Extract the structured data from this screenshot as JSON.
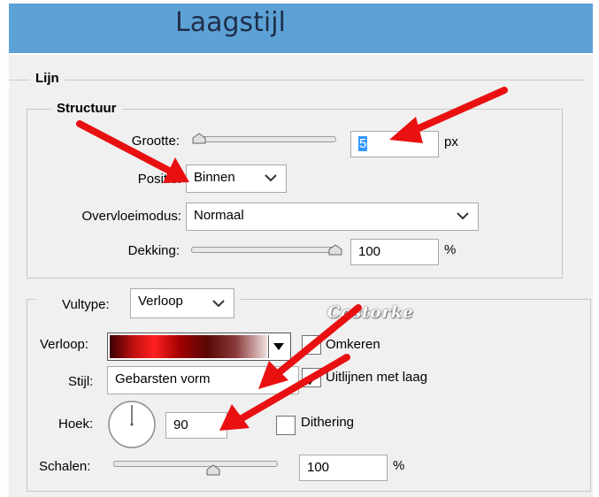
{
  "window": {
    "title": "Laagstijl"
  },
  "section": {
    "title": "Lijn"
  },
  "structure": {
    "title": "Structuur",
    "size_label": "Grootte:",
    "size_value": "5",
    "size_unit": "px",
    "size_slider_fraction": 0.05,
    "position_label": "Positie:",
    "position_value": "Binnen",
    "blend_label": "Overvloeimodus:",
    "blend_value": "Normaal",
    "opacity_label": "Dekking:",
    "opacity_value": "100",
    "opacity_unit": "%",
    "opacity_slider_fraction": 1.0
  },
  "fill": {
    "type_label": "Vultype:",
    "type_value": "Verloop",
    "gradient_label": "Verloop:",
    "reverse_label": "Omkeren",
    "reverse_checked": false,
    "style_label": "Stijl:",
    "style_value": "Gebarsten vorm",
    "align_label": "Uitlijnen met laag",
    "align_checked": true,
    "angle_label": "Hoek:",
    "angle_value": "90",
    "dither_label": "Dithering",
    "dither_checked": false,
    "scale_label": "Schalen:",
    "scale_value": "100",
    "scale_unit": "%"
  },
  "watermark": {
    "text": "Castorke"
  },
  "colors": {
    "titlebar": "#5da2d6",
    "panel": "#f0f0f0",
    "arrow": "#e81010",
    "gradient_stops": [
      "#3a0000",
      "#d01010",
      "#ff2020",
      "#8a0000",
      "#5a0a0a",
      "#e8d8d8"
    ]
  }
}
